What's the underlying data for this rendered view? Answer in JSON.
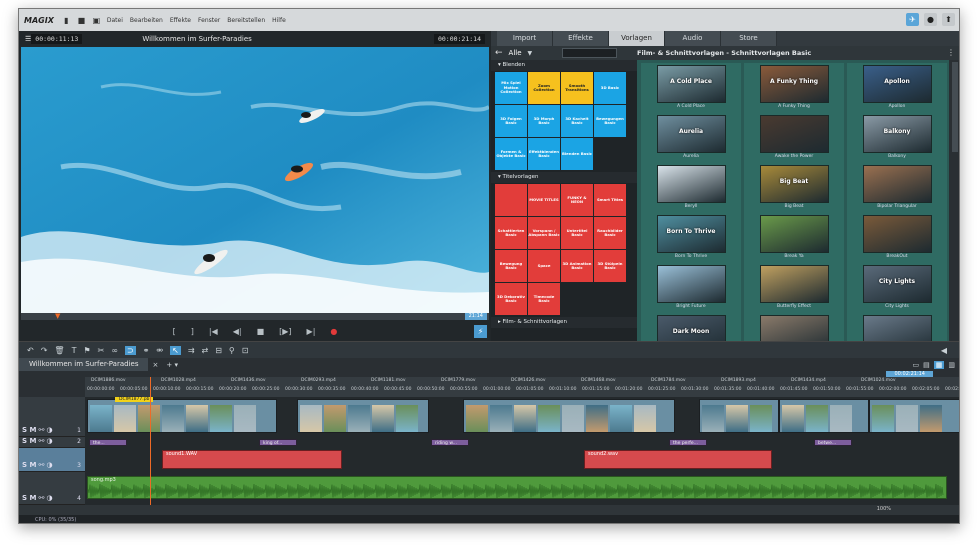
{
  "app": {
    "logo": "MAGIX",
    "menu": [
      "Datei",
      "Bearbeiten",
      "Effekte",
      "Fenster",
      "Bereitstellen",
      "Hilfe"
    ]
  },
  "preview": {
    "tc_left": "00:00:11:13",
    "title": "Willkommen im Surfer-Paradies",
    "tc_right": "00:00:21:14",
    "scrub_tc": "21:14",
    "colors": {
      "water": "#2b9fd1",
      "foam": "#e9f5fa"
    }
  },
  "pool": {
    "tabs": [
      "Import",
      "Effekte",
      "Vorlagen",
      "Audio",
      "Store"
    ],
    "active_tab": "Vorlagen",
    "dropdown": "Alle",
    "path": "Film- & Schnittvorlagen - Schnittvorlagen Basic",
    "cat_blenden": "Blenden",
    "cat_titel": "Titelvorlagen",
    "cat_film": "Film- & Schnittvorlagen",
    "blenden_tiles": [
      {
        "t": "Mix Spiel Motion Collection",
        "c": "blue"
      },
      {
        "t": "Zoom Collection",
        "c": "yellow"
      },
      {
        "t": "Smooth Transitions",
        "c": "yellow"
      },
      {
        "t": "3D Basic",
        "c": "blue"
      },
      {
        "t": "3D Folgen Basic",
        "c": "blue"
      },
      {
        "t": "3D Morph Basic",
        "c": "blue"
      },
      {
        "t": "3D Kachelt Basic",
        "c": "blue"
      },
      {
        "t": "Bewegungen Basic",
        "c": "blue"
      },
      {
        "t": "Formen & Objekte Basic",
        "c": "blue"
      },
      {
        "t": "Effektblenden Basic",
        "c": "blue"
      },
      {
        "t": "Blenden Basic",
        "c": "blue"
      },
      {
        "t": "",
        "c": "empty"
      }
    ],
    "titel_tiles": [
      {
        "t": "",
        "c": "red"
      },
      {
        "t": "MOVIE TITLES",
        "c": "red"
      },
      {
        "t": "FUNKY & NEON",
        "c": "red"
      },
      {
        "t": "Smart Titles",
        "c": "red"
      },
      {
        "t": "Schattierten Basic",
        "c": "red"
      },
      {
        "t": "Vorspann / Abspann Basic",
        "c": "red"
      },
      {
        "t": "Untertitel Basic",
        "c": "red"
      },
      {
        "t": "Rauchbilder Basic",
        "c": "red"
      },
      {
        "t": "Bewegung Basic",
        "c": "red"
      },
      {
        "t": "Space",
        "c": "red"
      },
      {
        "t": "3D Animation Basic",
        "c": "red"
      },
      {
        "t": "3D Stülpeln Basic",
        "c": "red"
      },
      {
        "t": "3D Dekorativ Basic",
        "c": "red"
      },
      {
        "t": "Timecode Basic",
        "c": "red"
      },
      {
        "t": "",
        "c": "empty"
      },
      {
        "t": "",
        "c": "empty"
      }
    ],
    "thumbs": [
      {
        "cap": "A Cold Place",
        "label": "A Cold Place",
        "bg": "#7a9ca6"
      },
      {
        "cap": "A Funky Thing",
        "label": "A Funky Thing",
        "bg": "#8a5a3a"
      },
      {
        "cap": "Apollon",
        "label": "Apollon",
        "bg": "#3a5f8a"
      },
      {
        "cap": "Aurelia",
        "label": "Aurelia",
        "bg": "#6f8f9f"
      },
      {
        "cap": "Awake the Power",
        "label": "",
        "bg": "#4a3a30"
      },
      {
        "cap": "Balkony",
        "label": "Balkony",
        "bg": "#8a9aa6"
      },
      {
        "cap": "Beryll",
        "label": "",
        "bg": "#d9e3ea"
      },
      {
        "cap": "Big Beat",
        "label": "Big Beat",
        "bg": "#a88a3a"
      },
      {
        "cap": "Bipolar Triangular",
        "label": "",
        "bg": "#9a7050"
      },
      {
        "cap": "Born To Thrive",
        "label": "Born To Thrive",
        "bg": "#4f8fa0"
      },
      {
        "cap": "Break Ya",
        "label": "",
        "bg": "#6a9a4a"
      },
      {
        "cap": "BreakOut",
        "label": "",
        "bg": "#7a5a3a"
      },
      {
        "cap": "Bright Future",
        "label": "",
        "bg": "#9ac0d8"
      },
      {
        "cap": "Butterfly Effect",
        "label": "",
        "bg": "#c0a060"
      },
      {
        "cap": "City Lights",
        "label": "City Lights",
        "bg": "#5a6a7a"
      },
      {
        "cap": "",
        "label": "Dark Moon",
        "bg": "#4a5a6a"
      },
      {
        "cap": "",
        "label": "",
        "bg": "#8a7a6a"
      },
      {
        "cap": "",
        "label": "",
        "bg": "#6a7a8a"
      }
    ]
  },
  "timeline": {
    "project_tab": "Willkommen im Surfer-Paradies",
    "clip_labels": [
      "DCIM1886.mov",
      "DCIM1028.mp4",
      "DCIM1436.mov",
      "DCIM0293.mp4",
      "DCIM1181.mov",
      "DCIM1779.mov",
      "DCIM1426.mov",
      "DCIM1468.mov",
      "DCIM1784.mov",
      "DCIM1893.mp4",
      "DCIM1434.mp4",
      "DCIM1024.mov"
    ],
    "times": [
      "00:00:00:00",
      "00:00:05:00",
      "00:00:10:00",
      "00:00:15:00",
      "00:00:20:00",
      "00:00:25:00",
      "00:00:30:00",
      "00:00:35:00",
      "00:00:40:00",
      "00:00:45:00",
      "00:00:50:00",
      "00:00:55:00",
      "00:01:00:00",
      "00:01:05:00",
      "00:01:10:00",
      "00:01:15:00",
      "00:01:20:00",
      "00:01:25:00",
      "00:01:30:00",
      "00:01:35:00",
      "00:01:40:00",
      "00:01:45:00",
      "00:01:50:00",
      "00:01:55:00",
      "00:02:00:00",
      "00:02:05:00",
      "00:02:10:00"
    ],
    "ruler_tc": "00:02:21:14",
    "subtitles": [
      "the...",
      "king of...",
      "riding w...",
      "the perfe...",
      "betwe..."
    ],
    "audio": [
      "sound1.WAV",
      "sound2.wav"
    ],
    "music": "song.mp3",
    "tracks": [
      "1",
      "2",
      "3",
      "4"
    ],
    "zoom": "100%",
    "status": "CPU: 0% (35/35)",
    "clip_tag": "DCIM1877.pb"
  }
}
